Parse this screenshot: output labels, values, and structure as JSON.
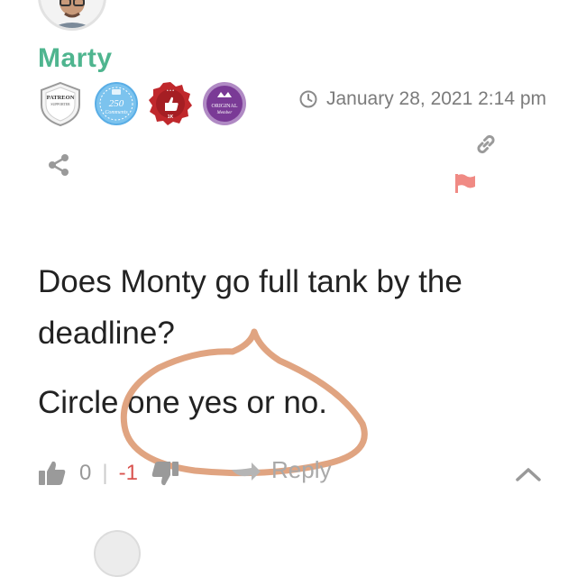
{
  "comment": {
    "author": "Marty",
    "timestamp": "January 28, 2021 2:14 pm",
    "paragraphs": [
      "Does Monty go full tank by the deadline?",
      "Circle one yes or no."
    ],
    "upvotes": "0",
    "separator": "|",
    "downvotes": "-1",
    "reply_label": "Reply"
  },
  "badges": [
    {
      "name": "patreon-supporter-badge",
      "text1": "PATREON",
      "text2": "SUPPORTER",
      "color": "#ffffff"
    },
    {
      "name": "250-comments-badge",
      "text1": "250",
      "text2": "Comments",
      "color": "#5aaee6"
    },
    {
      "name": "1k-likes-badge",
      "text1": "1K",
      "color": "#c0282c"
    },
    {
      "name": "original-member-badge",
      "text1": "ORIGINAL",
      "text2": "Member",
      "color": "#7a3a96"
    }
  ],
  "colors": {
    "username": "#4fb58f",
    "downvote": "#d9534f",
    "flag": "#f08a84",
    "annotation_circle": "#dd9a73"
  },
  "icons": [
    "clock-icon",
    "link-icon",
    "share-icon",
    "flag-icon",
    "thumbs-up-icon",
    "thumbs-down-icon",
    "reply-arrow-icon",
    "chevron-up-icon"
  ]
}
